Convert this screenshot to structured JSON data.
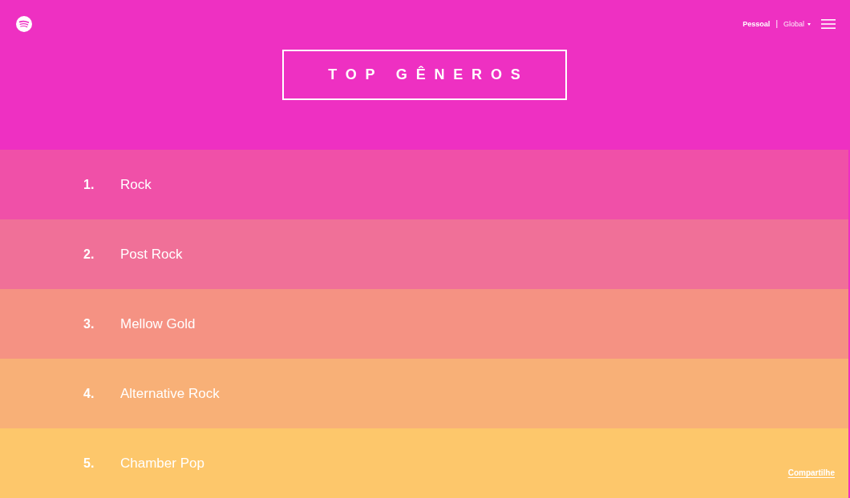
{
  "header": {
    "color": "#ee30c2",
    "nav": {
      "tabs": [
        {
          "label": "Pessoal",
          "selected": true
        },
        {
          "label": "Global",
          "selected": false
        }
      ],
      "separator": "|"
    },
    "title": "TOP GÊNEROS"
  },
  "genres": [
    {
      "rank": "1.",
      "name": "Rock",
      "color": "#f050a8"
    },
    {
      "rank": "2.",
      "name": "Post Rock",
      "color": "#f07098"
    },
    {
      "rank": "3.",
      "name": "Mellow Gold",
      "color": "#f59283"
    },
    {
      "rank": "4.",
      "name": "Alternative Rock",
      "color": "#f8b077"
    },
    {
      "rank": "5.",
      "name": "Chamber Pop",
      "color": "#fdc76b"
    }
  ],
  "share_link": "Compartilhe"
}
